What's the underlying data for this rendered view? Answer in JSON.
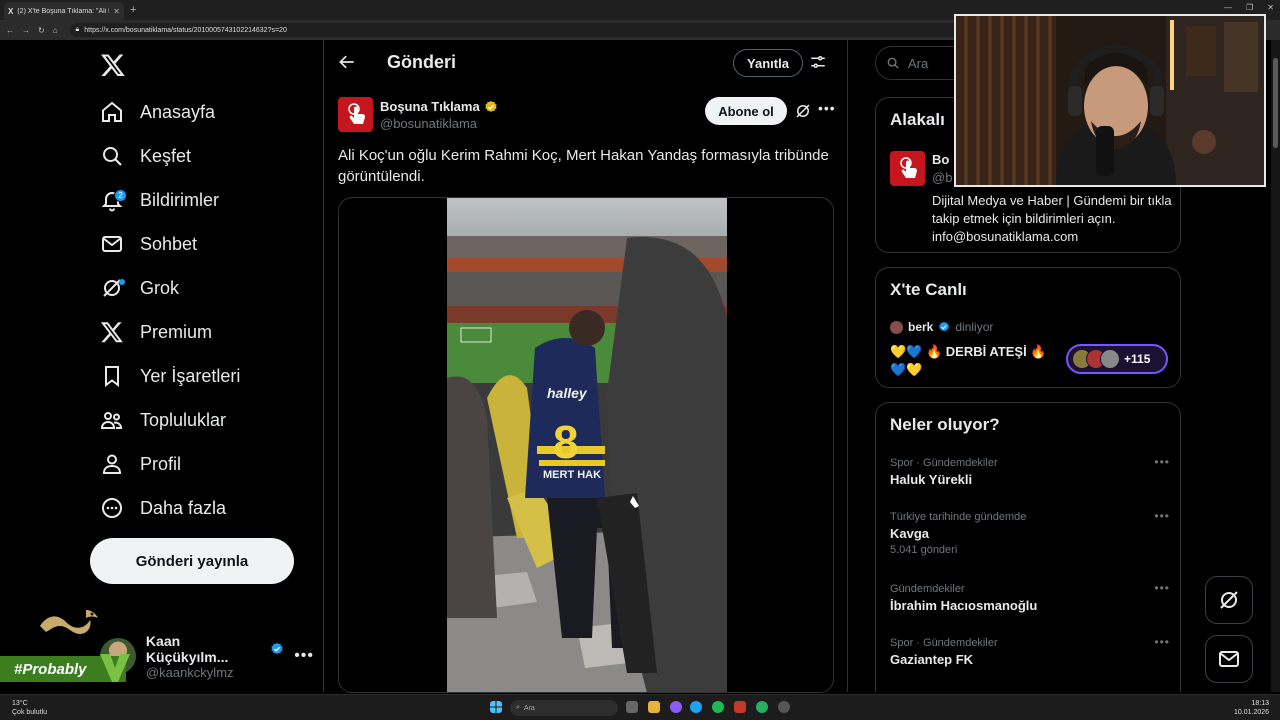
{
  "browser": {
    "tab_title": "(2) X'te Boşuna Tıklama: \"Ali K...",
    "url": "https://x.com/bosunatiklama/status/2010005743102214632?s=20"
  },
  "nav": {
    "items": [
      {
        "label": "Anasayfa",
        "icon": "home-icon"
      },
      {
        "label": "Keşfet",
        "icon": "search-icon"
      },
      {
        "label": "Bildirimler",
        "icon": "bell-icon",
        "badge": "2"
      },
      {
        "label": "Sohbet",
        "icon": "mail-icon"
      },
      {
        "label": "Grok",
        "icon": "grok-icon"
      },
      {
        "label": "Premium",
        "icon": "x-icon"
      },
      {
        "label": "Yer İşaretleri",
        "icon": "bookmark-icon"
      },
      {
        "label": "Topluluklar",
        "icon": "communities-icon"
      },
      {
        "label": "Profil",
        "icon": "profile-icon"
      },
      {
        "label": "Daha fazla",
        "icon": "more-circle-icon"
      }
    ],
    "post_button": "Gönderi yayınla"
  },
  "account": {
    "name": "Kaan Küçükyılm...",
    "handle": "@kaankckylmz"
  },
  "overlay": {
    "tag": "#Probably"
  },
  "main": {
    "title": "Gönderi",
    "reply_button": "Yanıtla",
    "tweet": {
      "author_name": "Boşuna Tıklama",
      "author_handle": "@bosunatiklama",
      "subscribe_button": "Abone ol",
      "text": "Ali Koç'un oğlu Kerim Rahmi Koç, Mert Hakan Yandaş formasıyla tribünde görüntülendi.",
      "jersey_number": "8",
      "jersey_name": "MERT HAK",
      "jersey_sponsor": "halley"
    }
  },
  "right": {
    "search_placeholder": "Ara",
    "related": {
      "title": "Alakalı",
      "name": "Bo",
      "handle": "@b",
      "bio": "Dijital Medya ve Haber | Gündemi bir tıkla takip etmek için bildirimleri açın. info@bosunatiklama.com"
    },
    "live": {
      "title": "X'te Canlı",
      "user": "berk",
      "status": "dinliyor",
      "space_title": "💛💙 🔥 DERBİ ATEŞİ 🔥 💙💛",
      "listeners": "+115"
    },
    "trends": {
      "title": "Neler oluyor?",
      "items": [
        {
          "context": "Spor · Gündemdekiler",
          "name": "Haluk Yürekli",
          "count": ""
        },
        {
          "context": "Türkiye tarihinde gündemde",
          "name": "Kavga",
          "count": "5.041 gönderi"
        },
        {
          "context": "Gündemdekiler",
          "name": "İbrahim Hacıosmanoğlu",
          "count": ""
        },
        {
          "context": "Spor · Gündemdekiler",
          "name": "Gaziantep FK",
          "count": ""
        }
      ]
    }
  },
  "taskbar": {
    "weather_temp": "13°C",
    "weather_desc": "Çok bulutlu",
    "search": "Ara",
    "time": "18:13",
    "date": "10.01.2026"
  },
  "colors": {
    "accent": "#1d9bf0",
    "brand_red": "#c4161c",
    "live_purple": "#7856ff",
    "overlay_green": "#3b7d1f"
  }
}
